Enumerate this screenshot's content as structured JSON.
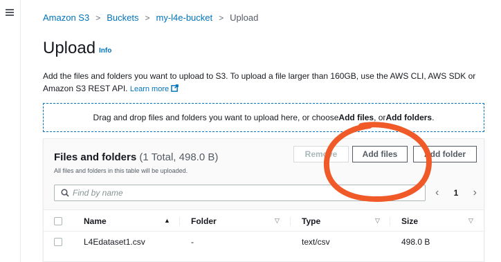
{
  "breadcrumb": {
    "items": [
      "Amazon S3",
      "Buckets",
      "my-l4e-bucket"
    ],
    "current": "Upload"
  },
  "page": {
    "title": "Upload",
    "info_label": "Info",
    "description": "Add the files and folders you want to upload to S3. To upload a file larger than 160GB, use the AWS CLI, AWS SDK or Amazon S3 REST API.",
    "learn_more": "Learn more"
  },
  "dropzone": {
    "text_before": "Drag and drop files and folders you want to upload here, or choose ",
    "add_files": "Add files",
    "separator": ", or ",
    "add_folders": "Add folders",
    "text_after": "."
  },
  "panel": {
    "title": "Files and folders",
    "count": "(1 Total, 498.0 B)",
    "subtitle": "All files and folders in this table will be uploaded.",
    "remove_label": "Remove",
    "add_files_label": "Add files",
    "add_folder_label": "Add folder",
    "search_placeholder": "Find by name",
    "current_page": "1"
  },
  "table": {
    "columns": [
      "Name",
      "Folder",
      "Type",
      "Size"
    ],
    "rows": [
      {
        "name": "L4Edataset1.csv",
        "folder": "-",
        "type": "text/csv",
        "size": "498.0 B"
      }
    ]
  },
  "colors": {
    "link": "#0073bb",
    "annotation": "#f05a28",
    "text": "#16191f",
    "muted": "#545b64"
  }
}
